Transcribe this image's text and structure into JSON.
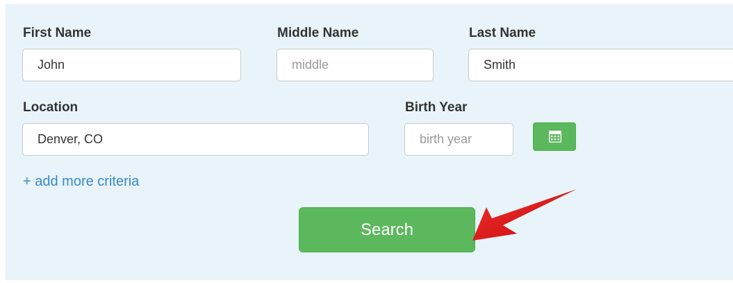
{
  "form": {
    "first_name": {
      "label": "First Name",
      "value": "John",
      "placeholder": ""
    },
    "middle_name": {
      "label": "Middle Name",
      "value": "",
      "placeholder": "middle"
    },
    "last_name": {
      "label": "Last Name",
      "value": "Smith",
      "placeholder": ""
    },
    "location": {
      "label": "Location",
      "value": "Denver, CO",
      "placeholder": ""
    },
    "birth_year": {
      "label": "Birth Year",
      "value": "",
      "placeholder": "birth year"
    },
    "add_more_label": "+ add more criteria",
    "search_label": "Search"
  },
  "icons": {
    "calendar": "calendar-icon",
    "annotation_arrow": "red-arrow-icon"
  },
  "colors": {
    "panel_background": "#e8f4f9",
    "button_green": "#5cb85c",
    "link_blue": "#3a87c8",
    "arrow_red": "#e01818"
  }
}
